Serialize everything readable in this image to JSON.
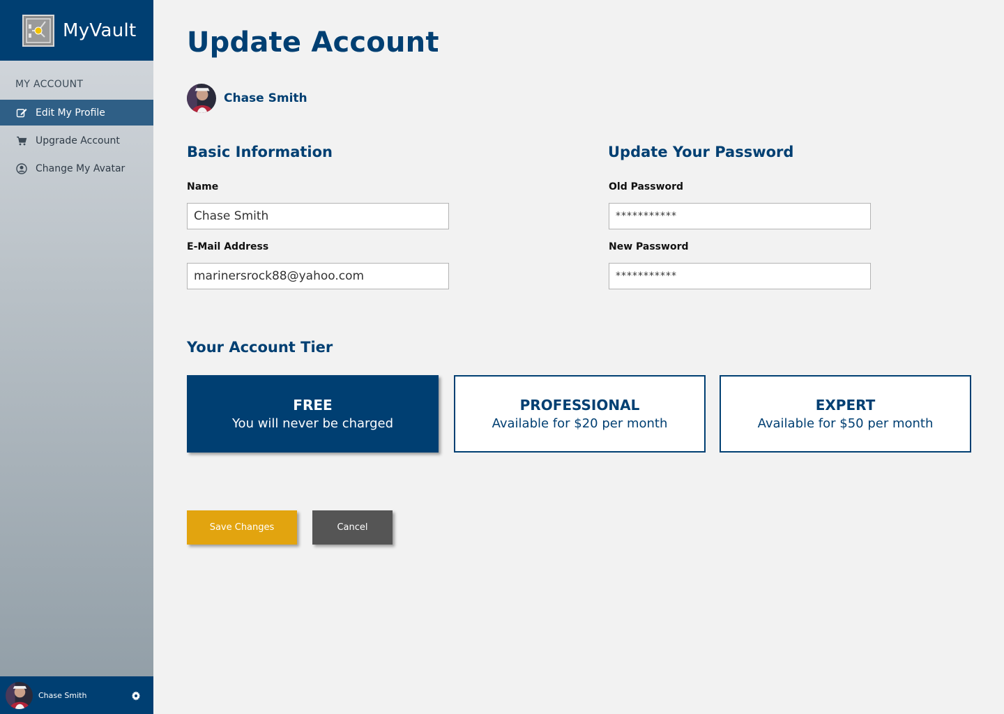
{
  "app": {
    "name": "MyVault"
  },
  "sidebar": {
    "section_title": "MY ACCOUNT",
    "items": [
      {
        "label": "Edit My Profile",
        "icon": "edit-icon",
        "active": true
      },
      {
        "label": "Upgrade Account",
        "icon": "cart-icon",
        "active": false
      },
      {
        "label": "Change My Avatar",
        "icon": "user-circle-icon",
        "active": false
      }
    ],
    "user": {
      "name": "Chase Smith"
    }
  },
  "page": {
    "title": "Update Account",
    "profile_name": "Chase Smith"
  },
  "basic_info": {
    "heading": "Basic Information",
    "name_label": "Name",
    "name_value": "Chase Smith",
    "email_label": "E-Mail Address",
    "email_value": "marinersrock88@yahoo.com"
  },
  "password": {
    "heading": "Update Your Password",
    "old_label": "Old Password",
    "old_value": "***********",
    "new_label": "New Password",
    "new_value": "***********"
  },
  "tiers": {
    "heading": "Your Account Tier",
    "options": [
      {
        "name": "FREE",
        "description": "You will never be charged",
        "selected": true
      },
      {
        "name": "PROFESSIONAL",
        "description": "Available for $20 per month",
        "selected": false
      },
      {
        "name": "EXPERT",
        "description": "Available for $50 per month",
        "selected": false
      }
    ]
  },
  "actions": {
    "save_label": "Save Changes",
    "cancel_label": "Cancel"
  },
  "colors": {
    "brand": "#003f72",
    "active_nav": "#2f5f86",
    "save": "#e2a40f",
    "cancel": "#555555"
  }
}
